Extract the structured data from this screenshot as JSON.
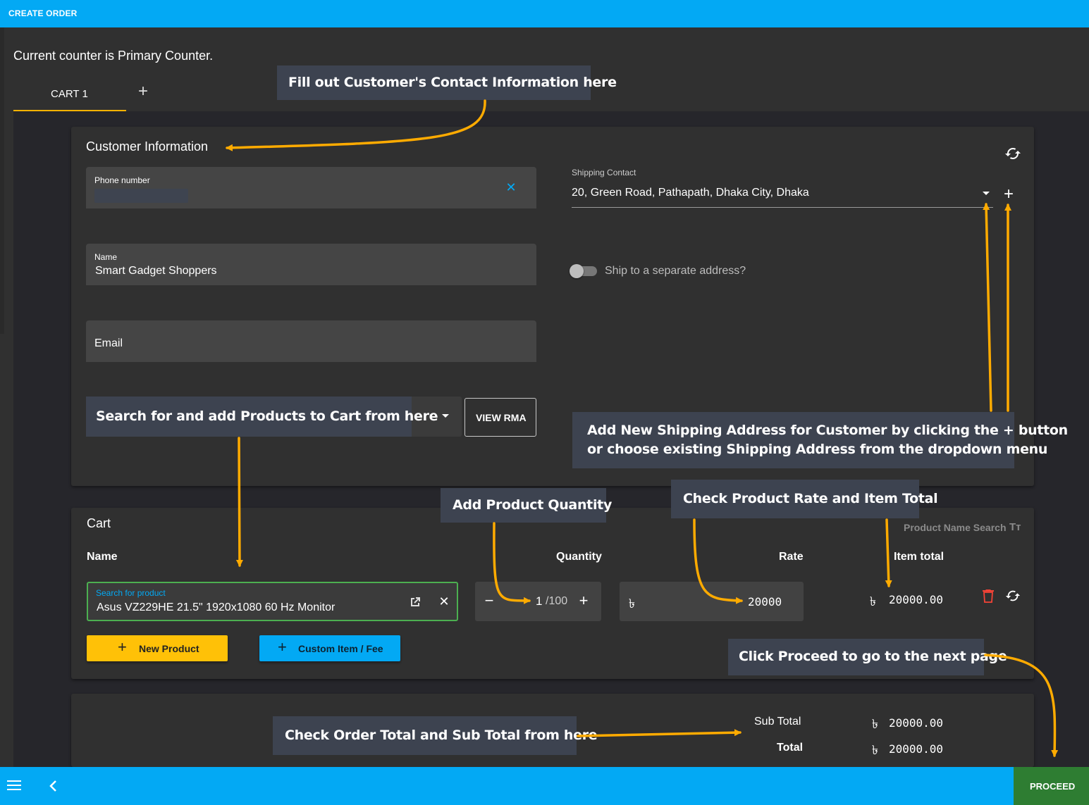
{
  "topbar": {
    "title": "CREATE ORDER"
  },
  "counter_text": "Current counter is Primary Counter.",
  "tabs": [
    {
      "label": "CART 1"
    }
  ],
  "add_tab_icon": "plus-icon",
  "customer": {
    "title": "Customer Information",
    "phone_label": "Phone number",
    "phone_value": "",
    "name_label": "Name",
    "name_value": "Smart Gadget Shoppers",
    "email_placeholder": "Email",
    "product_search_placeholder": "Search for and add Products to Cart from here",
    "view_rma_label": "VIEW RMA",
    "shipping_label": "Shipping Contact",
    "shipping_value": "20, Green Road, Pathapath, Dhaka City, Dhaka",
    "ship_separate_label": "Ship to a separate address?",
    "ship_separate_on": false
  },
  "cart": {
    "title": "Cart",
    "product_name_search_label": "Product Name Search",
    "headers": {
      "name": "Name",
      "quantity": "Quantity",
      "rate": "Rate",
      "item_total": "Item total"
    },
    "row": {
      "search_label": "Search for product",
      "product": "Asus VZ229HE 21.5\" 1920x1080 60 Hz Monitor",
      "quantity": "1",
      "quantity_max": "/100",
      "currency": "৳",
      "rate": "20000",
      "item_total": "20000.00"
    },
    "new_product_label": "New Product",
    "custom_item_label": "Custom Item / Fee"
  },
  "totals": {
    "sub_total_label": "Sub Total",
    "sub_total_value": "20000.00",
    "total_label": "Total",
    "total_value": "20000.00",
    "currency": "৳"
  },
  "bottombar": {
    "proceed_label": "PROCEED"
  },
  "callouts": {
    "contact": "Fill out Customer's Contact Information here",
    "shipping_line1": "Add New Shipping Address for Customer by clicking the + button",
    "shipping_line2": "or choose existing Shipping Address from the dropdown menu",
    "quantity": "Add Product Quantity",
    "rate": "Check Product Rate and Item Total",
    "proceed": "Click Proceed to go to the next page",
    "totals": "Check Order Total and Sub Total from here"
  },
  "colors": {
    "accent_blue": "#03a9f4",
    "accent_amber": "#ffb300",
    "proceed_green": "#2e7d32",
    "arrow": "#ffab00",
    "delete_red": "#f44336",
    "field_bg": "#454545",
    "callout_bg": "#3d4350"
  }
}
